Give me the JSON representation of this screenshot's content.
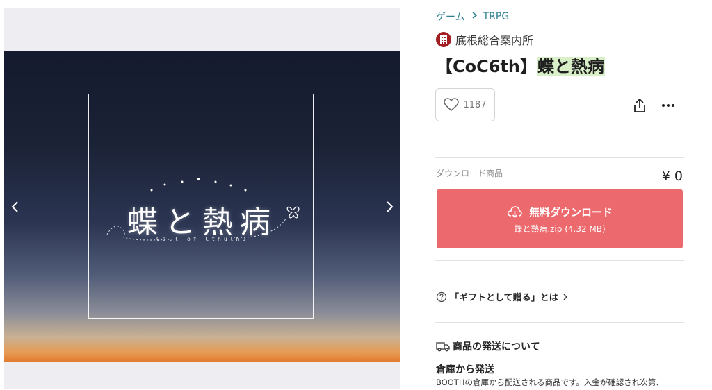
{
  "gallery": {
    "cover_title": "蝶と熱病",
    "cover_subtitle": "Call of Cthulhu"
  },
  "breadcrumb": {
    "items": [
      "ゲーム",
      "TRPG"
    ]
  },
  "shop": {
    "name": "底根総合案内所"
  },
  "product": {
    "title_prefix": "【CoC6th】",
    "title_highlight": "蝶と熱病"
  },
  "actions": {
    "like_count": "1187",
    "share_icon": "share-icon",
    "more_icon": "more-icon"
  },
  "variant": {
    "label": "ダウンロード商品",
    "price": "¥ 0"
  },
  "download": {
    "label": "無料ダウンロード",
    "file": "蝶と熱病.zip (4.32 MB)"
  },
  "gift": {
    "label": "「ギフトとして贈る」とは"
  },
  "shipping": {
    "title": "商品の発送について",
    "method": "倉庫から発送",
    "description": "BOOTHの倉庫から配送される商品です。入金が確認され次第、"
  },
  "colors": {
    "accent": "#ec6a6e",
    "link": "#2a7e90",
    "highlight": "#d8efc8"
  }
}
